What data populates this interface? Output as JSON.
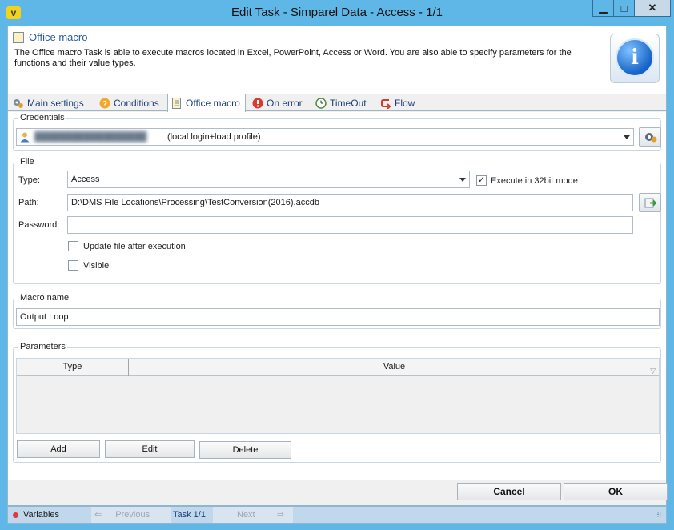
{
  "window": {
    "title": "Edit Task - Simparel Data - Access - 1/1",
    "logo_letter": "v",
    "minimize_glyph": "▁",
    "maximize_glyph": "□",
    "close_glyph": "✕"
  },
  "header": {
    "title": "Office macro",
    "description": "The Office macro Task is able to execute macros located in Excel, PowerPoint, Access or Word. You are also able to specify parameters for the functions and their value types.",
    "info_icon": "i"
  },
  "tabs": [
    {
      "label": "Main settings",
      "icon": "gears-icon"
    },
    {
      "label": "Conditions",
      "icon": "question-icon"
    },
    {
      "label": "Office macro",
      "icon": "document-icon",
      "active": true
    },
    {
      "label": "On error",
      "icon": "error-icon"
    },
    {
      "label": "TimeOut",
      "icon": "clock-icon"
    },
    {
      "label": "Flow",
      "icon": "flow-icon"
    }
  ],
  "credentials": {
    "label": "Credentials",
    "value_suffix": "(local login+load profile)"
  },
  "file": {
    "label": "File",
    "type_label": "Type:",
    "type_value": "Access",
    "execute_32bit_label": "Execute in 32bit mode",
    "execute_32bit_checked": true,
    "path_label": "Path:",
    "path_value": "D:\\DMS File Locations\\Processing\\TestConversion(2016).accdb",
    "password_label": "Password:",
    "password_value": "",
    "update_file_label": "Update file after execution",
    "update_file_checked": false,
    "visible_label": "Visible",
    "visible_checked": false
  },
  "macro": {
    "label": "Macro name",
    "value": "Output Loop"
  },
  "parameters": {
    "label": "Parameters",
    "columns": [
      "Type",
      "Value"
    ],
    "rows": [],
    "add_label": "Add",
    "edit_label": "Edit",
    "delete_label": "Delete"
  },
  "footer": {
    "cancel_label": "Cancel",
    "ok_label": "OK"
  },
  "statusbar": {
    "variables_label": "Variables",
    "previous_label": "Previous",
    "task_label": "Task 1/1",
    "next_label": "Next"
  }
}
